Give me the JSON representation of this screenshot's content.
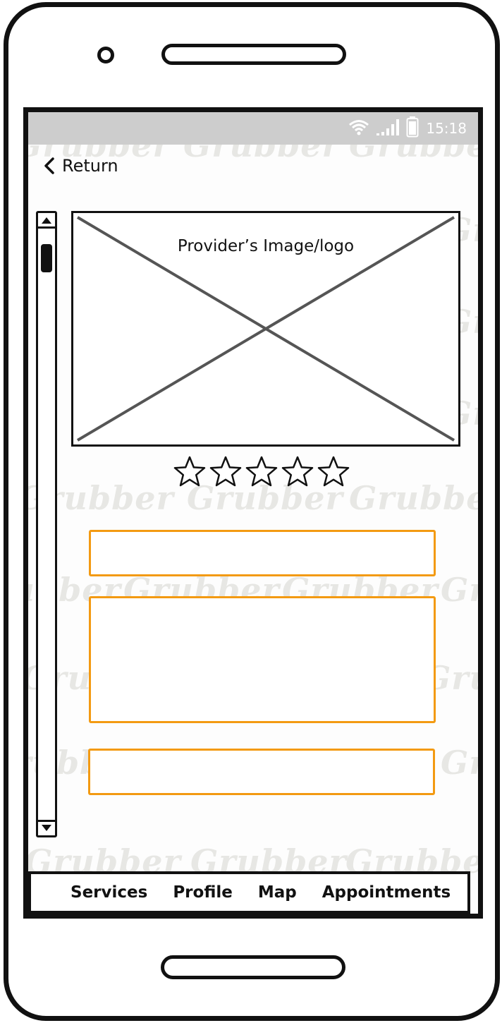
{
  "watermark": {
    "text": "Grubber"
  },
  "status_bar": {
    "time": "15:18",
    "icons": [
      "wifi-icon",
      "signal-icon",
      "battery-icon"
    ]
  },
  "header": {
    "return_label": "Return",
    "return_icon": "chevron-left-icon"
  },
  "provider": {
    "image_label": "Provider’s Image/logo",
    "rating": {
      "max": 5,
      "filled": 0
    }
  },
  "bottom_nav": {
    "items": [
      {
        "label": "Services"
      },
      {
        "label": "Profile"
      },
      {
        "label": "Map"
      },
      {
        "label": "Appointments"
      }
    ]
  },
  "colors": {
    "field_border": "#f39a12",
    "status_bar_bg": "#cdcdcd",
    "watermark": "#e7e7e4",
    "outline": "#111111"
  }
}
